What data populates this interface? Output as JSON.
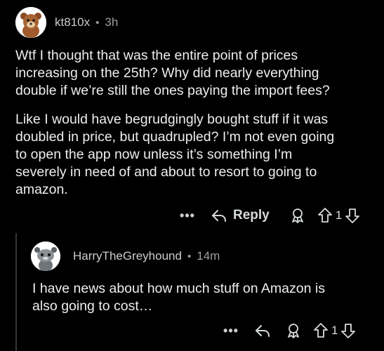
{
  "comment": {
    "author": "kt810x",
    "separator": "•",
    "time": "3h",
    "paragraphs": [
      "Wtf I thought that was the entire point of prices\nincreasing on the 25th? Why did nearly everything\ndouble if we’re still the ones paying the import fees?",
      "Like I would have begrudgingly bought stuff if it was\ndoubled in price, but quadrupled? I’m not even going\nto open the app now unless it’s something I’m\nseverely in need of and about to resort to going to\namazon."
    ],
    "actions": {
      "more": "•••",
      "reply_label": "Reply",
      "award_icon": "award-icon",
      "upvote_icon": "upvote-arrow-icon",
      "vote_count": "1",
      "downvote_icon": "downvote-arrow-icon"
    }
  },
  "reply": {
    "author": "HarryTheGreyhound",
    "separator": "•",
    "time": "14m",
    "text": "I have news about how much stuff on Amazon is\nalso going to cost…",
    "actions": {
      "more": "•••",
      "reply_icon": "reply-arrow-icon",
      "award_icon": "award-icon",
      "upvote_icon": "upvote-arrow-icon",
      "vote_count": "1",
      "downvote_icon": "downvote-arrow-icon"
    }
  },
  "colors": {
    "background": "#000000",
    "text": "#eceeef",
    "meta": "#9a9fa3",
    "threadline": "#343536"
  }
}
